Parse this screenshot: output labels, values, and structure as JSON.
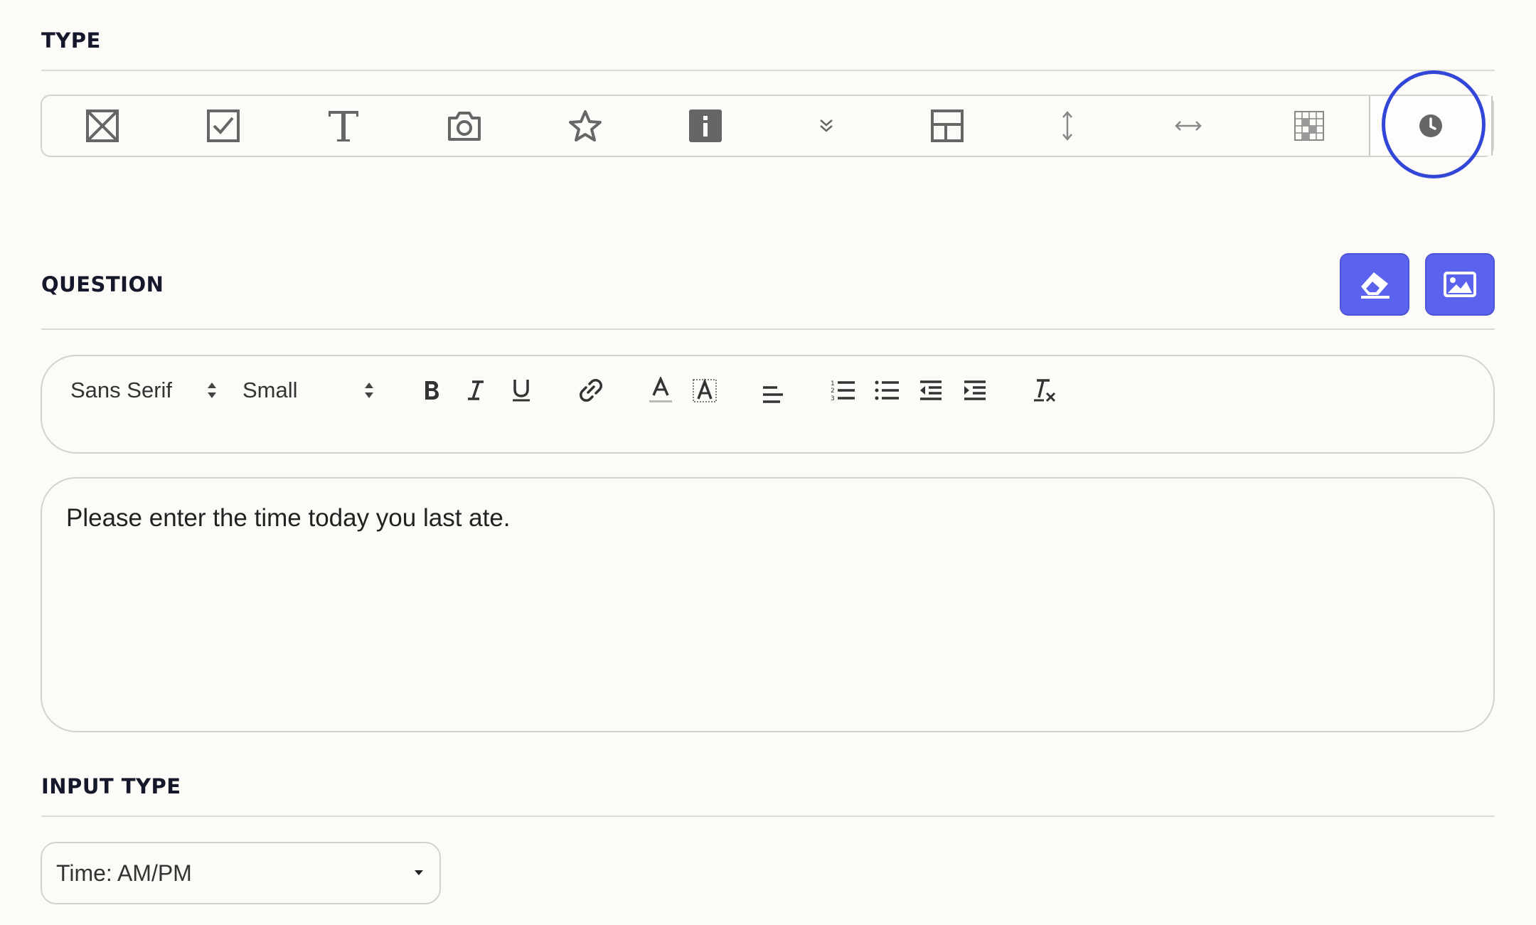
{
  "sections": {
    "type_title": "TYPE",
    "question_title": "QUESTION",
    "input_type_title": "INPUT TYPE"
  },
  "type_toolbar": {
    "items": [
      {
        "name": "checkbox-cross-icon"
      },
      {
        "name": "checkbox-check-icon"
      },
      {
        "name": "text-icon"
      },
      {
        "name": "camera-icon"
      },
      {
        "name": "star-icon"
      },
      {
        "name": "info-icon"
      },
      {
        "name": "double-chevron-down-icon"
      },
      {
        "name": "layout-icon"
      },
      {
        "name": "vertical-resize-icon"
      },
      {
        "name": "horizontal-resize-icon"
      },
      {
        "name": "grid-table-icon"
      },
      {
        "name": "clock-icon",
        "selected": true
      }
    ]
  },
  "editor_toolbar": {
    "font_family": "Sans Serif",
    "font_size": "Small"
  },
  "question": {
    "text": "Please enter the time today you last ate."
  },
  "input_type": {
    "selected": "Time: AM/PM"
  },
  "colors": {
    "accent": "#5b63ee",
    "highlight_ring": "#3246d8",
    "background": "#fcfbf7"
  }
}
